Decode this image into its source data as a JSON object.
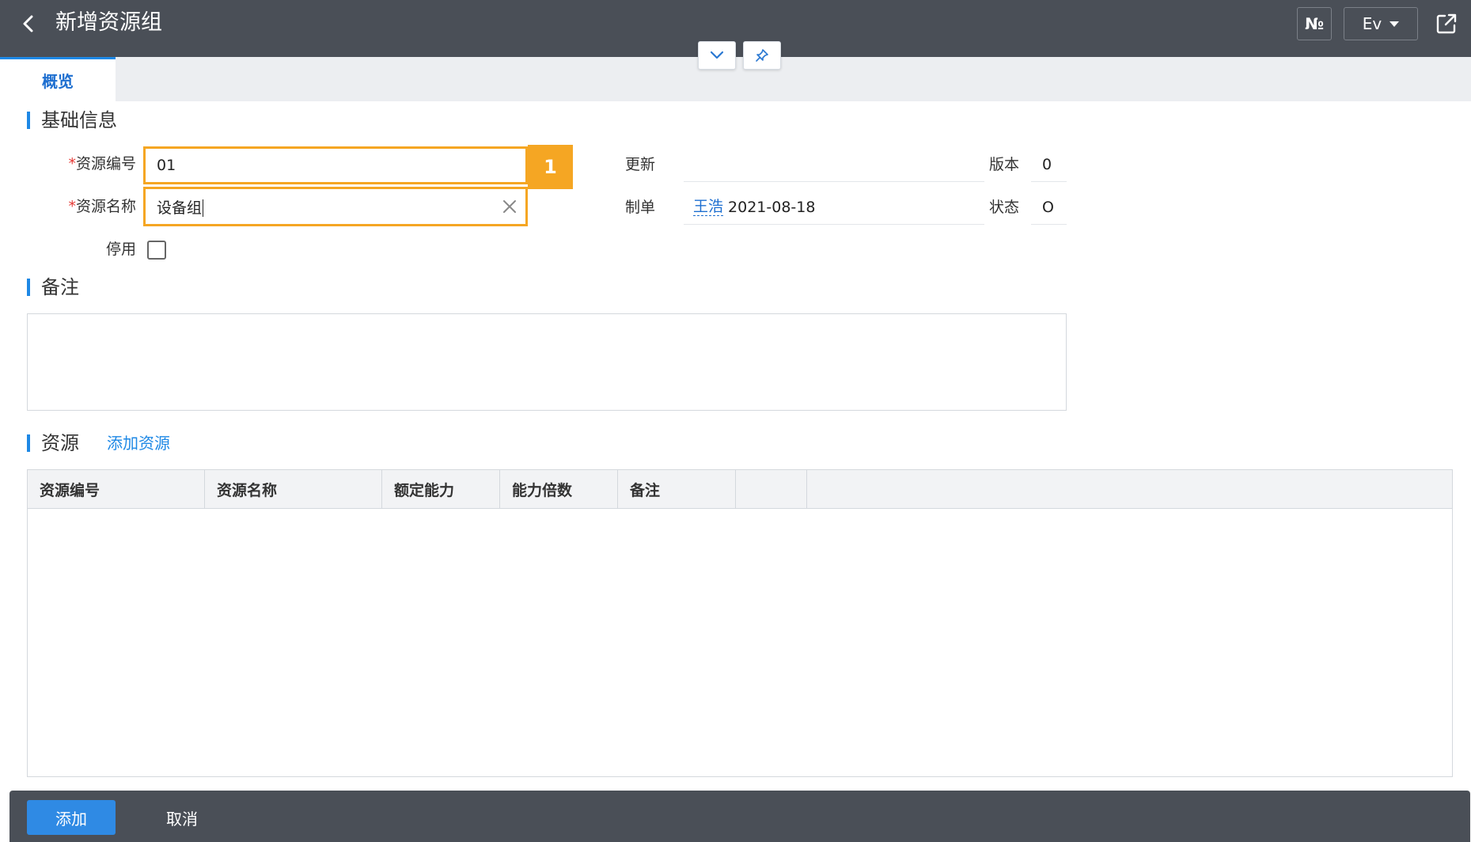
{
  "header": {
    "title": "新增资源组",
    "no_label": "№",
    "lang_label": "Ev",
    "back_icon": "back-arrow-icon",
    "share_icon": "open-external-icon"
  },
  "tabs": [
    {
      "label": "概览",
      "active": true
    }
  ],
  "basic_info": {
    "section_title": "基础信息",
    "code_label": "资源编号",
    "code_value": "01",
    "name_label": "资源名称",
    "name_value": "设备组",
    "disabled_label": "停用",
    "disabled_checked": false,
    "update_label": "更新",
    "update_value": "",
    "creator_label": "制单",
    "creator_name": "王浩",
    "creator_date": "2021-08-18",
    "version_label": "版本",
    "version_value": "0",
    "status_label": "状态",
    "status_value": "O",
    "step_badge": "1"
  },
  "remark": {
    "section_title": "备注",
    "value": ""
  },
  "resources": {
    "section_title": "资源",
    "add_link": "添加资源",
    "columns": [
      "资源编号",
      "资源名称",
      "额定能力",
      "能力倍数",
      "备注",
      ""
    ],
    "rows": []
  },
  "footer": {
    "add_label": "添加",
    "cancel_label": "取消"
  },
  "colors": {
    "accent": "#1e88e5",
    "highlight": "#f5a623",
    "topbar": "#4a4f57"
  }
}
